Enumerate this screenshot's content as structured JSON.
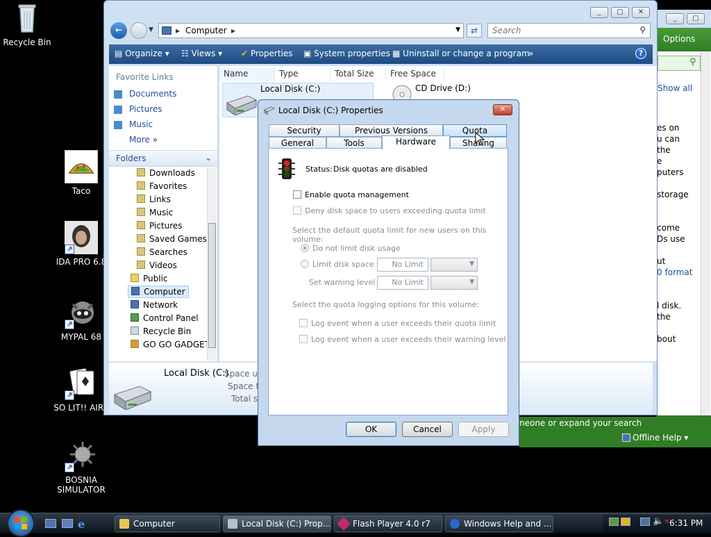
{
  "desktop": {
    "icons": [
      {
        "label": "Recycle Bin"
      },
      {
        "label": "Taco"
      },
      {
        "label": "IDA PRO 6.8"
      },
      {
        "label": "MYPAL 68"
      },
      {
        "label": "SO LIT!! AIRE"
      },
      {
        "label": "BOSNIA SIMULATOR"
      }
    ]
  },
  "explorer": {
    "address": "Computer",
    "search_placeholder": "Search",
    "toolbar": {
      "organize": "Organize",
      "views": "Views",
      "properties": "Properties",
      "system_properties": "System properties",
      "uninstall": "Uninstall or change a program",
      "more": "»"
    },
    "favorite_links_heading": "Favorite Links",
    "favorite_links": [
      "Documents",
      "Pictures",
      "Music"
    ],
    "more_label": "More",
    "folders_heading": "Folders",
    "folders": [
      "Downloads",
      "Favorites",
      "Links",
      "Music",
      "Pictures",
      "Saved Games",
      "Searches",
      "Videos"
    ],
    "folders_root": [
      "Public",
      "Computer",
      "Network",
      "Control Panel",
      "Recycle Bin",
      "GO GO GADGET"
    ],
    "columns": [
      "Name",
      "Type",
      "Total Size",
      "Free Space"
    ],
    "items": [
      {
        "name": "Local Disk (C:)"
      },
      {
        "name": "CD Drive (D:)"
      }
    ],
    "details": {
      "name": "Local Disk (C:)",
      "line1": "Space use",
      "line2": "Space fr",
      "line3": "Total si"
    }
  },
  "help_window": {
    "options": "Options",
    "show_all": "Show all",
    "fragments": [
      "es on",
      "u can",
      "the",
      "e",
      "puters",
      "storage",
      "come",
      "Ds use",
      "ut",
      "0 format",
      "l disk.",
      "the",
      "bout"
    ],
    "status_text": "neone or expand your search",
    "offline_help": "Offline Help"
  },
  "dialog": {
    "title": "Local Disk (C:) Properties",
    "tabs_row1": [
      "Security",
      "Previous Versions",
      "Quota"
    ],
    "tabs_row2": [
      "General",
      "Tools",
      "Hardware",
      "Sharing"
    ],
    "status_label": "Status:",
    "status_value": "Disk quotas are disabled",
    "enable_quota": "Enable quota management",
    "deny_disk": "Deny disk space to users exceeding quota limit",
    "select_default": "Select the default quota limit for new users on this volume:",
    "no_limit_radio": "Do not limit disk usage",
    "limit_radio": "Limit disk space to",
    "limit_value": "No Limit",
    "warning_label": "Set warning level to",
    "warning_value": "No Limit",
    "select_logging": "Select the quota logging options for this volume:",
    "log_quota": "Log event when a user exceeds their quota limit",
    "log_warning": "Log event when a user exceeds their warning level",
    "ok": "OK",
    "cancel": "Cancel",
    "apply": "Apply"
  },
  "taskbar": {
    "tasks": [
      "Computer",
      "Local Disk (C:) Prop...",
      "Flash Player 4.0 r7",
      "Windows Help and ..."
    ],
    "clock": "6:31 PM"
  }
}
